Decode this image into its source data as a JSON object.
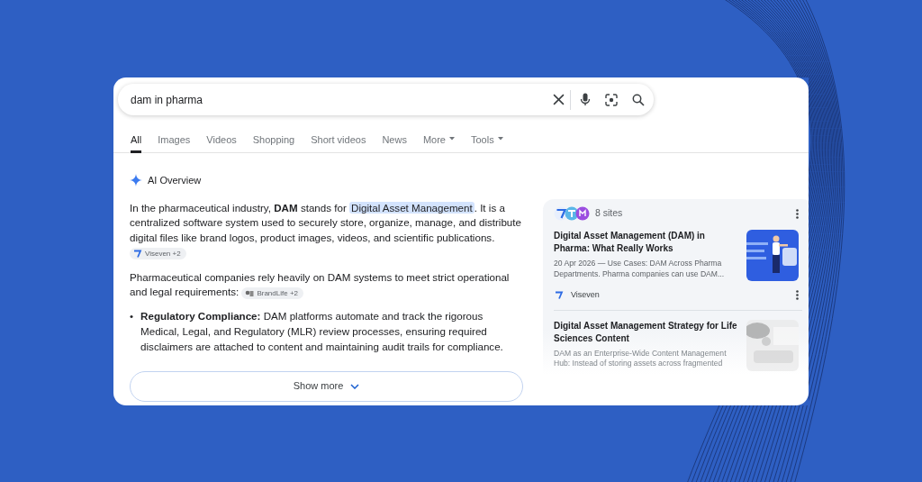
{
  "search": {
    "query": "dam in pharma"
  },
  "tabs": [
    {
      "label": "All",
      "selected": true,
      "dropdown": false
    },
    {
      "label": "Images",
      "selected": false,
      "dropdown": false
    },
    {
      "label": "Videos",
      "selected": false,
      "dropdown": false
    },
    {
      "label": "Shopping",
      "selected": false,
      "dropdown": false
    },
    {
      "label": "Short videos",
      "selected": false,
      "dropdown": false
    },
    {
      "label": "News",
      "selected": false,
      "dropdown": false
    },
    {
      "label": "More",
      "selected": false,
      "dropdown": true
    },
    {
      "label": "Tools",
      "selected": false,
      "dropdown": true
    }
  ],
  "ai_overview": {
    "title": "AI Overview",
    "paragraphs": [
      {
        "segments": [
          {
            "text": "In the pharmaceutical industry, **DAM** stands for ",
            "highlighted": false
          },
          {
            "text": "Digital Asset Management",
            "highlighted": true
          },
          {
            "text": ". It is a centralized software system used to securely store, organize, manage, and distribute digital files like brand logos, product images, videos, and scientific publications.",
            "highlighted": false
          }
        ],
        "source_chip": "Viseven +2"
      },
      {
        "segments": [
          {
            "text": "Pharmaceutical companies rely heavily on DAM systems to meet strict operational and legal requirements:",
            "highlighted": false
          }
        ],
        "source_chip": "BrandLife +2"
      }
    ],
    "bullets": [
      {
        "marker": "•",
        "text": "**Regulatory Compliance:** DAM platforms automate and track the rigorous Medical, Legal, and Regulatory (MLR) review processes, ensuring required disclaimers are attached to content and maintaining audit trails for compliance."
      }
    ],
    "show_more": "Show more"
  },
  "sources": {
    "count_label": "8 sites",
    "results": [
      {
        "title": "Digital Asset Management (DAM) in Pharma: What Really Works",
        "snippet": "20 Apr 2026 — Use Cases: DAM Across Pharma Departments. Pharma companies can use DAM...",
        "source": "Viseven"
      },
      {
        "title": "Digital Asset Management Strategy for Life Sciences Content",
        "snippet": "DAM as an Enterprise-Wide Content Management Hub: Instead of storing assets across fragmented"
      }
    ]
  }
}
